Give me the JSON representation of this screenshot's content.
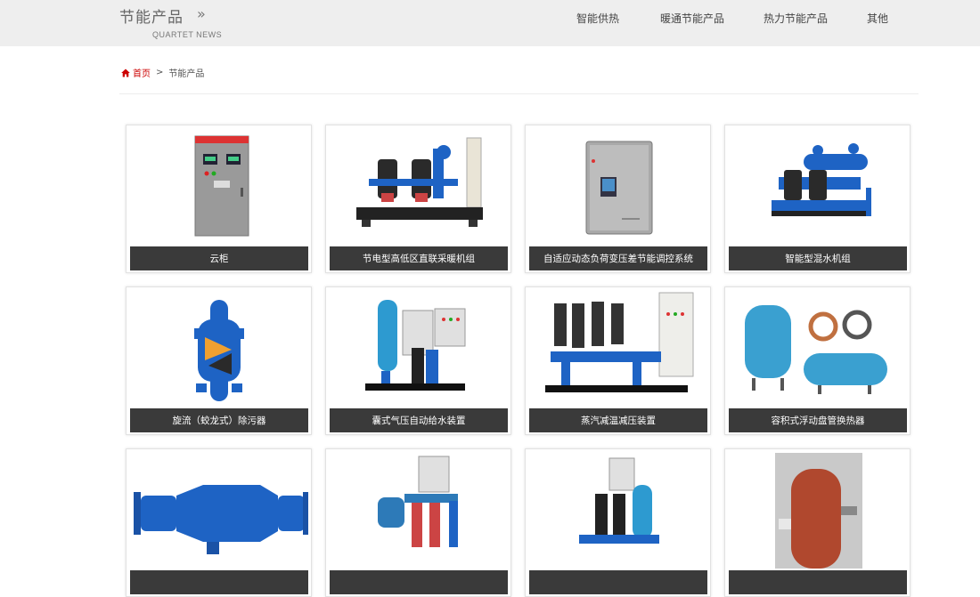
{
  "header": {
    "title": "节能产品",
    "arrow": "»",
    "subtitle": "QUARTET NEWS"
  },
  "nav": {
    "items": [
      {
        "label": "智能供热"
      },
      {
        "label": "暖通节能产品"
      },
      {
        "label": "热力节能产品"
      },
      {
        "label": "其他"
      }
    ]
  },
  "breadcrumb": {
    "home": "首页",
    "separator": ">",
    "current": "节能产品"
  },
  "products": [
    {
      "caption": "云柜",
      "image": "cabinet"
    },
    {
      "caption": "节电型高低区直联采暖机组",
      "image": "pump-unit"
    },
    {
      "caption": "自适应动态负荷变压差节能调控系统",
      "image": "control-box"
    },
    {
      "caption": "智能型混水机组",
      "image": "mixing-unit"
    },
    {
      "caption": "旋流（蛟龙式）除污器",
      "image": "cyclone-filter"
    },
    {
      "caption": "囊式气压自动给水装置",
      "image": "pressure-tank-unit"
    },
    {
      "caption": "蒸汽减温减压装置",
      "image": "steam-reducer"
    },
    {
      "caption": "容积式浮动盘管换热器",
      "image": "heat-exchanger"
    },
    {
      "caption": "",
      "image": "blue-filter"
    },
    {
      "caption": "",
      "image": "supply-unit"
    },
    {
      "caption": "",
      "image": "booster-unit"
    },
    {
      "caption": "",
      "image": "red-tank"
    }
  ],
  "colors": {
    "header_bg": "#eeeeee",
    "caption_bg": "#3a3a3a",
    "breadcrumb_home": "#cc0000",
    "equipment_blue": "#1e63c4"
  }
}
